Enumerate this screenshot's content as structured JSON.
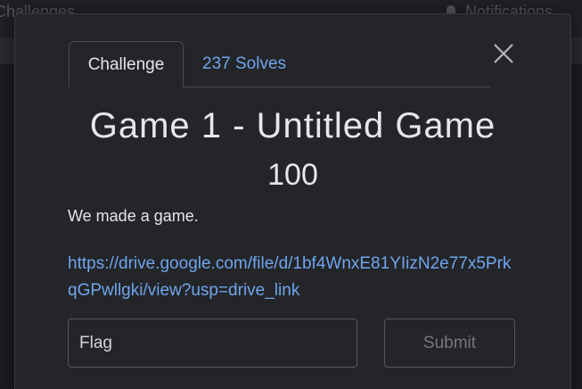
{
  "background": {
    "nav_title": "Challenges",
    "notifications_label": "Notifications"
  },
  "modal": {
    "tabs": [
      {
        "label": "Challenge",
        "active": true
      },
      {
        "label": "237 Solves",
        "active": false
      }
    ],
    "title": "Game 1 - Untitled Game",
    "points": "100",
    "description": "We made a game.",
    "link": "https://drive.google.com/file/d/1bf4WnxE81YIizN2e77x5PrkqGPwllgki/view?usp=drive_link",
    "flag_input": {
      "value": "",
      "placeholder": "Flag"
    },
    "submit_label": "Submit"
  },
  "colors": {
    "accent_link": "#6ea5ee",
    "modal_bg": "#242528",
    "text": "#e6e7ea"
  }
}
